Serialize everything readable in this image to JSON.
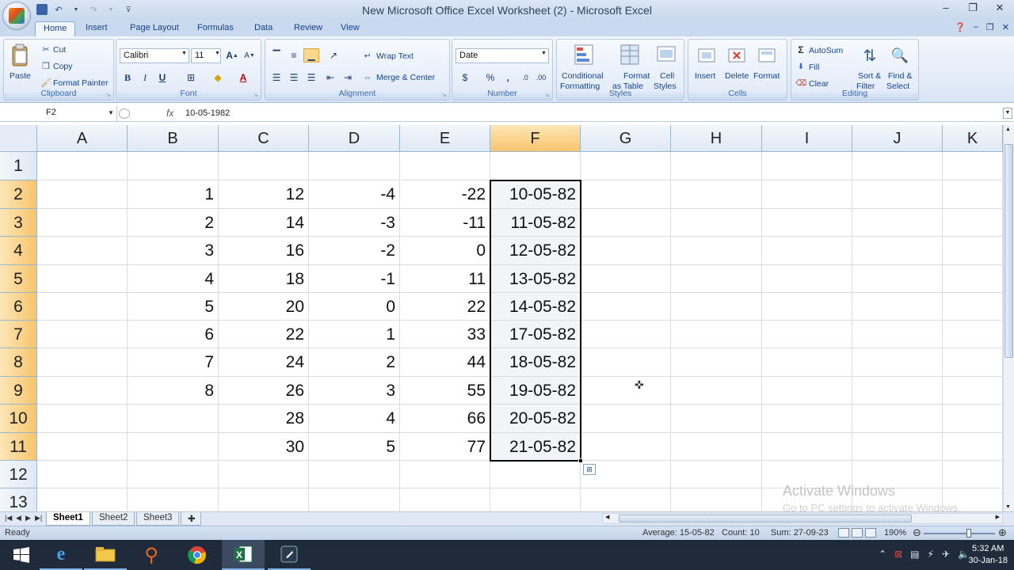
{
  "window": {
    "title": "New Microsoft Office Excel Worksheet (2) - Microsoft Excel",
    "controls": [
      "minimize-icon",
      "restore-icon",
      "close-icon"
    ]
  },
  "ribbon_tabs": [
    "Home",
    "Insert",
    "Page Layout",
    "Formulas",
    "Data",
    "Review",
    "View"
  ],
  "active_tab": "Home",
  "ribbon": {
    "clipboard": {
      "paste": "Paste",
      "cut": "Cut",
      "copy": "Copy",
      "format_painter": "Format Painter",
      "label": "Clipboard"
    },
    "font": {
      "name": "Calibri",
      "size": "11",
      "bold": "B",
      "italic": "I",
      "underline": "U",
      "label": "Font"
    },
    "alignment": {
      "wrap_text": "Wrap Text",
      "merge_center": "Merge & Center",
      "label": "Alignment"
    },
    "number": {
      "format": "Date",
      "currency": "$",
      "percent": "%",
      "comma": ",",
      "label": "Number"
    },
    "styles": {
      "conditional": "Conditional",
      "conditional2": "Formatting",
      "format_table": "Format",
      "format_table2": "as Table",
      "cell_styles": "Cell",
      "cell_styles2": "Styles",
      "label": "Styles"
    },
    "cells": {
      "insert": "Insert",
      "delete": "Delete",
      "format": "Format",
      "label": "Cells"
    },
    "editing": {
      "autosum": "AutoSum",
      "fill": "Fill",
      "clear": "Clear",
      "sort": "Sort &",
      "sort2": "Filter",
      "find": "Find &",
      "find2": "Select",
      "label": "Editing"
    }
  },
  "formula_bar": {
    "name_box": "F2",
    "fx": "fx",
    "content": "10-05-1982"
  },
  "columns": [
    "A",
    "B",
    "C",
    "D",
    "E",
    "F",
    "G",
    "H",
    "I",
    "J",
    "K"
  ],
  "selected_column": "F",
  "rows": [
    "1",
    "2",
    "3",
    "4",
    "5",
    "6",
    "7",
    "8",
    "9",
    "10",
    "11",
    "12",
    "13"
  ],
  "selected_rows": [
    "2",
    "3",
    "4",
    "5",
    "6",
    "7",
    "8",
    "9",
    "10",
    "11"
  ],
  "cells": {
    "B": [
      "",
      "1",
      "2",
      "3",
      "4",
      "5",
      "6",
      "7",
      "8",
      "",
      "",
      "",
      ""
    ],
    "C": [
      "",
      "12",
      "14",
      "16",
      "18",
      "20",
      "22",
      "24",
      "26",
      "28",
      "30",
      "",
      ""
    ],
    "D": [
      "",
      "-4",
      "-3",
      "-2",
      "-1",
      "0",
      "1",
      "2",
      "3",
      "4",
      "5",
      "",
      ""
    ],
    "E": [
      "",
      "-22",
      "-11",
      "0",
      "11",
      "22",
      "33",
      "44",
      "55",
      "66",
      "77",
      "",
      ""
    ],
    "F": [
      "",
      "10-05-82",
      "11-05-82",
      "12-05-82",
      "13-05-82",
      "14-05-82",
      "17-05-82",
      "18-05-82",
      "19-05-82",
      "20-05-82",
      "21-05-82",
      "",
      ""
    ]
  },
  "watermark": {
    "line1": "Activate Windows",
    "line2": "Go to PC settings to activate Windows."
  },
  "sheets": [
    "Sheet1",
    "Sheet2",
    "Sheet3"
  ],
  "active_sheet": "Sheet1",
  "status": {
    "ready": "Ready",
    "average": "Average: 15-05-82",
    "count": "Count: 10",
    "sum": "Sum: 27-09-23",
    "zoom": "190%"
  },
  "taskbar": {
    "apps": [
      "start-icon",
      "internet-explorer-icon",
      "file-explorer-icon",
      "search-app-icon",
      "chrome-icon",
      "excel-icon",
      "media-app-icon"
    ],
    "time": "5:32 AM",
    "date": "30-Jan-18"
  }
}
